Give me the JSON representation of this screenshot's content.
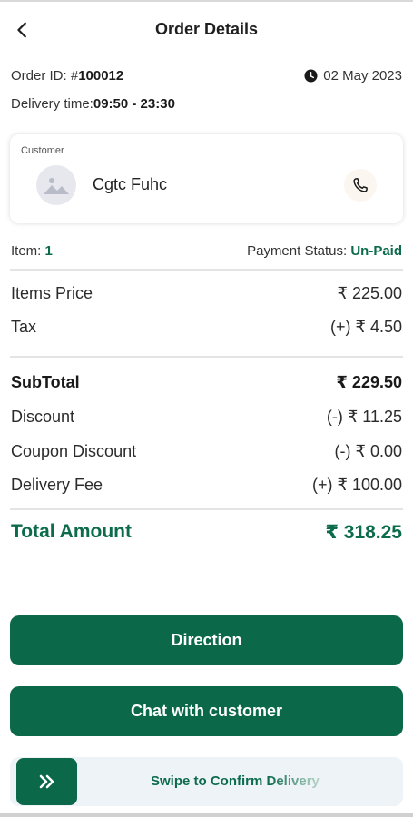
{
  "header": {
    "title": "Order Details",
    "back_icon": "back-arrow-icon"
  },
  "order": {
    "id_label": "Order ID: # ",
    "id_value": "100012",
    "date": "02 May 2023",
    "date_icon": "clock-icon",
    "delivery_label": "Delivery time: ",
    "delivery_value": "09:50 - 23:30"
  },
  "customer": {
    "label": "Customer",
    "name": "Cgtc Fuhc",
    "avatar_icon": "image-placeholder-icon",
    "call_icon": "phone-icon"
  },
  "items": {
    "label": "Item: ",
    "count": "1",
    "payment_label": "Payment Status: ",
    "payment_status": "Un-Paid"
  },
  "summary": {
    "items_price_label": "Items Price",
    "items_price": "₹ 225.00",
    "tax_label": "Tax",
    "tax": "(+) ₹ 4.50",
    "subtotal_label": "SubTotal",
    "subtotal": "₹ 229.50",
    "discount_label": "Discount",
    "discount": "(-) ₹ 11.25",
    "coupon_label": "Coupon Discount",
    "coupon": "(-) ₹ 0.00",
    "delivery_fee_label": "Delivery Fee",
    "delivery_fee": "(+) ₹ 100.00",
    "total_label": "Total Amount",
    "total": "₹ 318.25"
  },
  "actions": {
    "direction": "Direction",
    "chat": "Chat with customer",
    "swipe_text": "Swipe to Confirm Delivery",
    "swipe_icon": "double-chevron-right-icon"
  },
  "colors": {
    "accent": "#0b6848",
    "payment_status": "#0c6b4b"
  }
}
